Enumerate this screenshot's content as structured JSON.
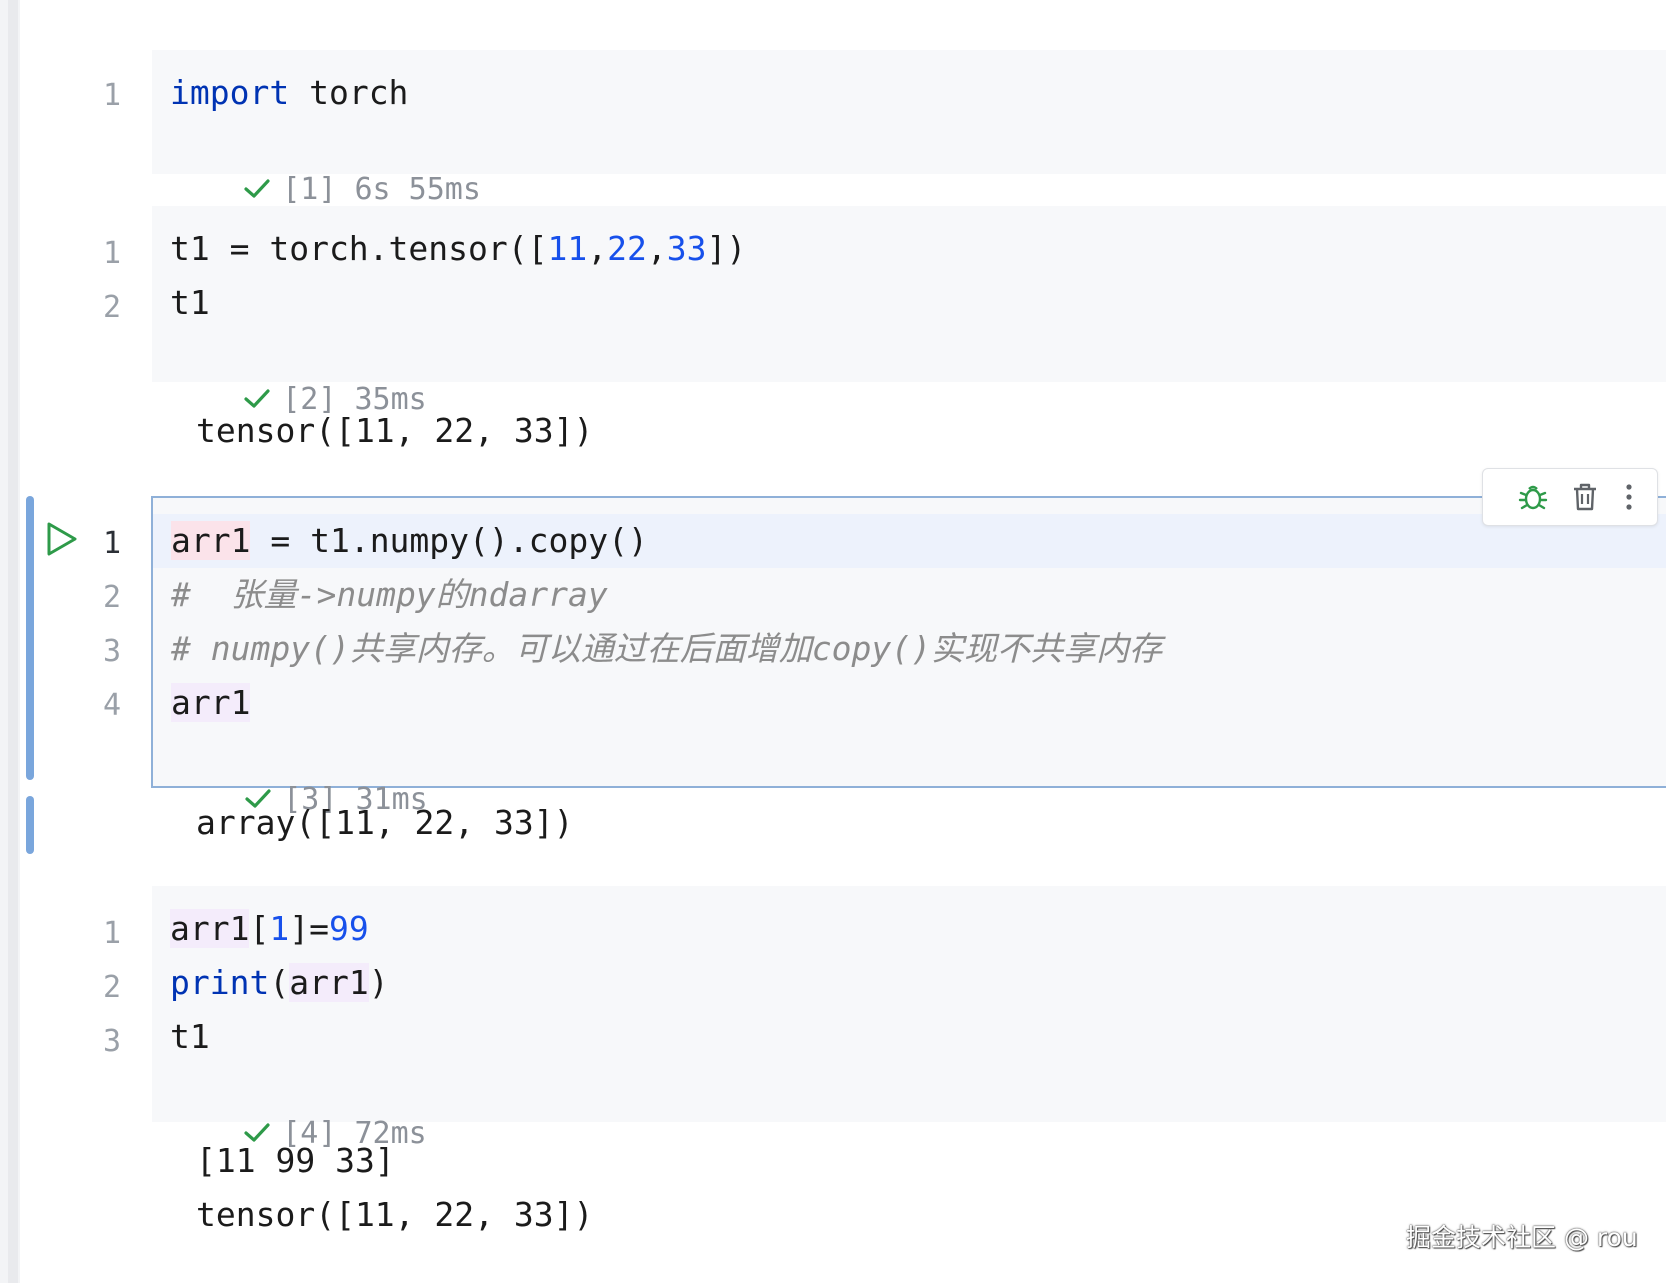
{
  "cells": [
    {
      "lines": [
        "1"
      ],
      "code": [
        [
          "import",
          " torch"
        ]
      ],
      "status": {
        "exec": "[1]",
        "time": "6s 55ms"
      }
    },
    {
      "lines": [
        "1",
        "2"
      ],
      "code": {
        "l1": {
          "a": "t1 = torch.tensor([",
          "n1": "11",
          "c1": ",",
          "n2": "22",
          "c2": ",",
          "n3": "33",
          "e": "])"
        },
        "l2": "t1"
      },
      "status": {
        "exec": "[2]",
        "time": "35ms"
      },
      "output": [
        "tensor([11, 22, 33])"
      ]
    },
    {
      "lines": [
        "1",
        "2",
        "3",
        "4"
      ],
      "code": {
        "l1_var": "arr1",
        "l1_rest": " = t1.numpy().copy()",
        "l2": "#  张量->numpy的ndarray",
        "l3": "# numpy()共享内存。可以通过在后面增加copy()实现不共享内存",
        "l4": "arr1"
      },
      "status": {
        "exec": "[3]",
        "time": "31ms"
      },
      "output": [
        "array([11, 22, 33])"
      ]
    },
    {
      "lines": [
        "1",
        "2",
        "3"
      ],
      "code": {
        "l1": {
          "var": "arr1",
          "a": "[",
          "n1": "1",
          "b": "]=",
          "n2": "99"
        },
        "l2": {
          "kw": "print",
          "a": "(",
          "var": "arr1",
          "b": ")"
        },
        "l3": "t1"
      },
      "status": {
        "exec": "[4]",
        "time": "72ms"
      },
      "output": [
        "[11 99 33]",
        "tensor([11, 22, 33])"
      ]
    }
  ],
  "toolbar": {
    "icons": [
      "debug-icon",
      "trash-icon",
      "more-vertical-icon"
    ]
  },
  "watermark": "掘金技术社区 @ rou",
  "colors": {
    "keyword": "#0033b3",
    "number": "#1750eb",
    "comment": "#8c8c8c",
    "success": "#2e9a49",
    "active_border": "#8fb0d8"
  }
}
